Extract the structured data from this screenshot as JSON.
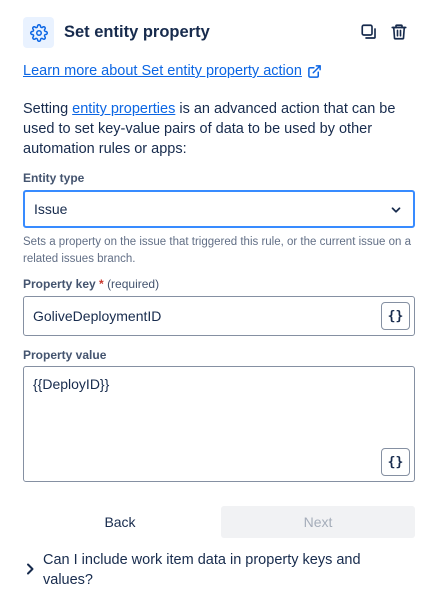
{
  "header": {
    "title": "Set entity property",
    "icon": "gear-icon",
    "copy_icon": "copy-icon",
    "delete_icon": "trash-icon"
  },
  "learn_more": {
    "label": "Learn more about Set entity property action",
    "icon": "external-link-icon"
  },
  "description": {
    "prefix": "Setting ",
    "link": "entity properties",
    "suffix": " is an advanced action that can be used to set key-value pairs of data to be used by other automation rules or apps:"
  },
  "entity_type": {
    "label": "Entity type",
    "value": "Issue",
    "helper": "Sets a property on the issue that triggered this rule, or the current issue on a related issues branch."
  },
  "property_key": {
    "label": "Property key",
    "required_mark": "*",
    "required_text": "(required)",
    "value": "GoliveDeploymentID",
    "brace_label": "{}"
  },
  "property_value": {
    "label": "Property value",
    "value": "{{DeployID}}",
    "brace_label": "{}"
  },
  "actions": {
    "back": "Back",
    "next": "Next"
  },
  "faq": {
    "question": "Can I include work item data in property keys and values?"
  },
  "colors": {
    "accent": "#0c66e4",
    "focus_border": "#388bff",
    "required": "#c9372c",
    "icon_bg": "#e9f2ff"
  }
}
